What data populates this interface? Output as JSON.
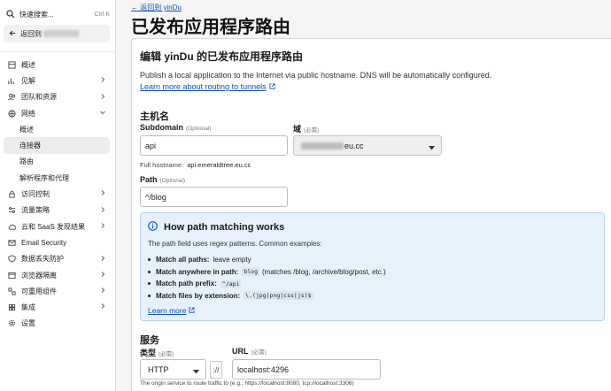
{
  "sidebar": {
    "search_label": "快速搜索...",
    "search_shortcut": "Ctrl K",
    "back_label": "返回到",
    "nav": [
      {
        "label": "概述",
        "chevron": false,
        "sub": false,
        "active": false
      },
      {
        "label": "见解",
        "chevron": true,
        "sub": false,
        "active": false
      },
      {
        "label": "团队和资源",
        "chevron": true,
        "sub": false,
        "active": false
      },
      {
        "label": "网络",
        "chevron": true,
        "sub": false,
        "active": false,
        "expanded": true
      },
      {
        "label": "概述",
        "chevron": false,
        "sub": true,
        "active": false
      },
      {
        "label": "连接器",
        "chevron": false,
        "sub": true,
        "active": true
      },
      {
        "label": "路由",
        "chevron": false,
        "sub": true,
        "active": false
      },
      {
        "label": "解析程序和代理",
        "chevron": false,
        "sub": true,
        "active": false
      },
      {
        "label": "访问控制",
        "chevron": true,
        "sub": false,
        "active": false
      },
      {
        "label": "流量策略",
        "chevron": true,
        "sub": false,
        "active": false
      },
      {
        "label": "云和 SaaS 发现结果",
        "chevron": true,
        "sub": false,
        "active": false
      },
      {
        "label": "Email Security",
        "chevron": false,
        "sub": false,
        "active": false
      },
      {
        "label": "数据丢失防护",
        "chevron": true,
        "sub": false,
        "active": false
      },
      {
        "label": "浏览器隔离",
        "chevron": true,
        "sub": false,
        "active": false
      },
      {
        "label": "可重用组件",
        "chevron": true,
        "sub": false,
        "active": false
      },
      {
        "label": "集成",
        "chevron": true,
        "sub": false,
        "active": false
      },
      {
        "label": "设置",
        "chevron": false,
        "sub": false,
        "active": false
      }
    ]
  },
  "main": {
    "back_link": "← 返回到 yinDu",
    "page_title": "已发布应用程序路由",
    "card_title": "编辑 yinDu 的已发布应用程序路由",
    "description": "Publish a local application to the Internet via public hostname. DNS will be automatically configured.",
    "learn_link": "Learn more about routing to tunnels",
    "hostname_section": "主机名",
    "subdomain_label": "Subdomain",
    "subdomain_optional": "(Optional)",
    "subdomain_value": "api",
    "domain_label": "域",
    "domain_required": "(必需)",
    "domain_value_suffix": "eu.cc",
    "full_hostname_label": "Full hostname:",
    "full_hostname_value": "api.emeraldtree.eu.cc",
    "path_label": "Path",
    "path_optional": "(Optional)",
    "path_value": "^/blog",
    "info": {
      "title": "How path matching works",
      "subtitle": "The path field uses regex patterns. Common examples:",
      "items": [
        {
          "bold": "Match all paths:",
          "code": "",
          "text": "leave empty"
        },
        {
          "bold": "Match anywhere in path:",
          "code": "blog",
          "text": "(matches /blog, /archive/blog/post, etc.)"
        },
        {
          "bold": "Match path prefix:",
          "code": "^/api",
          "text": ""
        },
        {
          "bold": "Match files by extension:",
          "code": "\\.(jpg|png|css|js)$",
          "text": ""
        }
      ],
      "learn_more": "Learn more"
    },
    "service_section": "服务",
    "type_label": "类型",
    "type_required": "(必需)",
    "type_value": "HTTP",
    "separator": "://",
    "url_label": "URL",
    "url_required": "(必需)",
    "url_value": "localhost:4296",
    "url_hint": "The origin service to route traffic to (e.g., https://localhost:8080, tcp://localhost:3306)"
  }
}
